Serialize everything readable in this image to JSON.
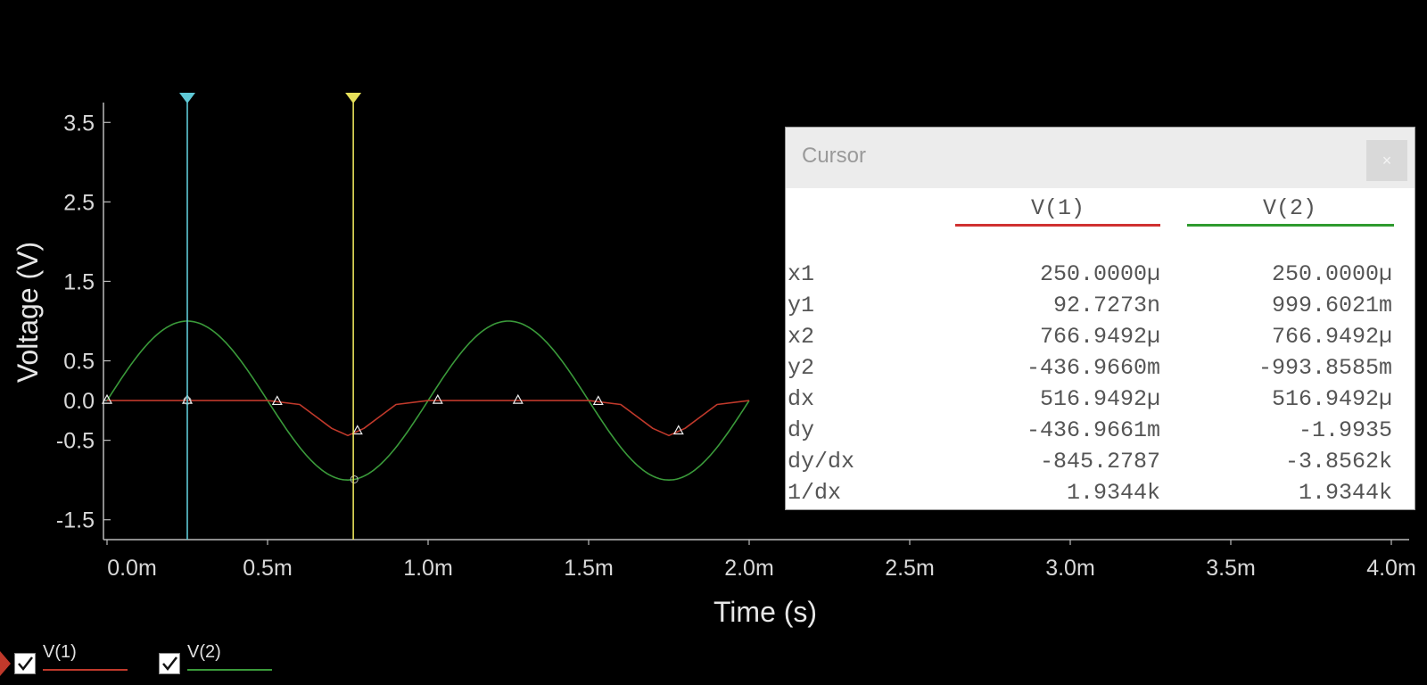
{
  "chart_data": {
    "type": "line",
    "xlabel": "Time (s)",
    "ylabel": "Voltage (V)",
    "xlim": [
      0,
      0.004
    ],
    "ylim": [
      -1.75,
      3.75
    ],
    "x_ticks": [
      "0.0m",
      "0.5m",
      "1.0m",
      "1.5m",
      "2.0m",
      "2.5m",
      "3.0m",
      "3.5m",
      "4.0m"
    ],
    "x_tick_values": [
      0,
      0.0005,
      0.001,
      0.0015,
      0.002,
      0.0025,
      0.003,
      0.0035,
      0.004
    ],
    "y_ticks": [
      "3.5",
      "2.5",
      "1.5",
      "0.5",
      "0.0",
      "-0.5",
      "-1.5"
    ],
    "y_tick_values": [
      3.5,
      2.5,
      1.5,
      0.5,
      0.0,
      -0.5,
      -1.5
    ],
    "series": [
      {
        "name": "V(1)",
        "color": "#c0392b",
        "x": [
          0,
          0.00025,
          0.0005,
          0.0006,
          0.00065,
          0.0007,
          0.00075,
          0.0008,
          0.00085,
          0.0009,
          0.001,
          0.00125,
          0.0015,
          0.0016,
          0.00165,
          0.0017,
          0.00175,
          0.0018,
          0.00185,
          0.0019,
          0.002
        ],
        "values": [
          0,
          0,
          0,
          -0.05,
          -0.2,
          -0.35,
          -0.44,
          -0.35,
          -0.2,
          -0.05,
          0,
          0,
          0,
          -0.05,
          -0.2,
          -0.35,
          -0.44,
          -0.35,
          -0.2,
          -0.05,
          0
        ]
      },
      {
        "name": "V(2)",
        "color": "#3a9a3a",
        "function": "sine",
        "amplitude": 1.0,
        "frequency_hz": 1000,
        "x_range": [
          0,
          0.002
        ]
      }
    ],
    "markers": {
      "V(1)": [
        0,
        0.00025,
        0.00053,
        0.00078,
        0.00103,
        0.00128,
        0.00153,
        0.00178
      ],
      "V(2)": [
        0.00025,
        0.00077
      ]
    },
    "cursors": [
      {
        "id": "cursor-1",
        "x": 0.00025,
        "color": "#5fc9d6"
      },
      {
        "id": "cursor-2",
        "x": 0.000767,
        "color": "#e6e05a"
      }
    ],
    "grid": false
  },
  "cursor_panel": {
    "title": "Cursor",
    "close_label": "×",
    "columns": [
      {
        "name": "V(1)",
        "color": "#d03030"
      },
      {
        "name": "V(2)",
        "color": "#2e9a2e"
      }
    ],
    "rows": [
      {
        "label": "x1",
        "v1": "250.0000µ",
        "v2": "250.0000µ"
      },
      {
        "label": "y1",
        "v1": "92.7273n",
        "v2": "999.6021m"
      },
      {
        "label": "x2",
        "v1": "766.9492µ",
        "v2": "766.9492µ"
      },
      {
        "label": "y2",
        "v1": "-436.9660m",
        "v2": "-993.8585m"
      },
      {
        "label": "dx",
        "v1": "516.9492µ",
        "v2": "516.9492µ"
      },
      {
        "label": "dy",
        "v1": "-436.9661m",
        "v2": "-1.9935"
      },
      {
        "label": "dy/dx",
        "v1": "-845.2787",
        "v2": "-3.8562k"
      },
      {
        "label": "1/dx",
        "v1": "1.9344k",
        "v2": "1.9344k"
      }
    ]
  },
  "legend": [
    {
      "name": "V(1)",
      "checked": true,
      "color": "#c0392b"
    },
    {
      "name": "V(2)",
      "checked": true,
      "color": "#3a9a3a"
    }
  ]
}
